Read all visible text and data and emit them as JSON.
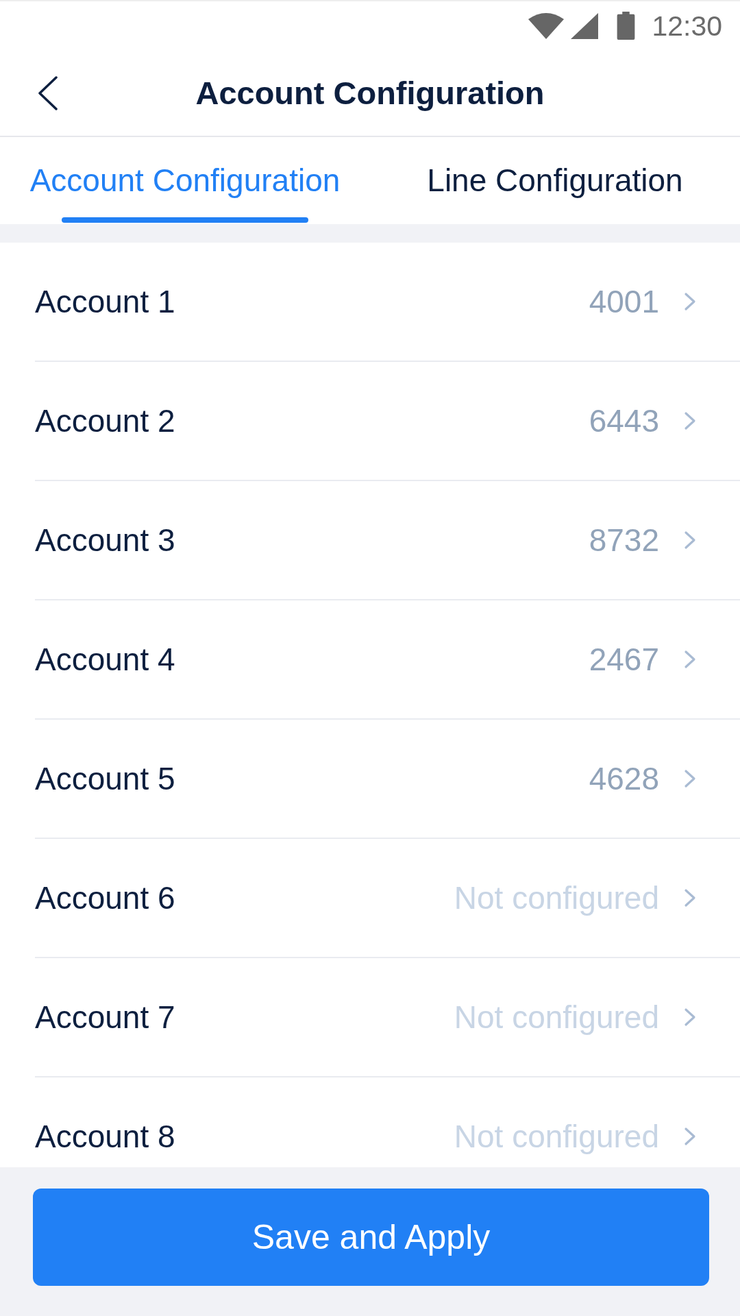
{
  "status_bar": {
    "time": "12:30"
  },
  "header": {
    "title": "Account Configuration"
  },
  "tabs": [
    {
      "label": "Account Configuration",
      "selected": true
    },
    {
      "label": "Line Configuration",
      "selected": false
    }
  ],
  "accounts": [
    {
      "name": "Account 1",
      "value": "4001",
      "configured": true
    },
    {
      "name": "Account 2",
      "value": "6443",
      "configured": true
    },
    {
      "name": "Account 3",
      "value": "8732",
      "configured": true
    },
    {
      "name": "Account 4",
      "value": "2467",
      "configured": true
    },
    {
      "name": "Account 5",
      "value": "4628",
      "configured": true
    },
    {
      "name": "Account 6",
      "value": "Not configured",
      "configured": false
    },
    {
      "name": "Account 7",
      "value": "Not configured",
      "configured": false
    },
    {
      "name": "Account 8",
      "value": "Not configured",
      "configured": false
    }
  ],
  "footer": {
    "button": "Save and Apply"
  }
}
